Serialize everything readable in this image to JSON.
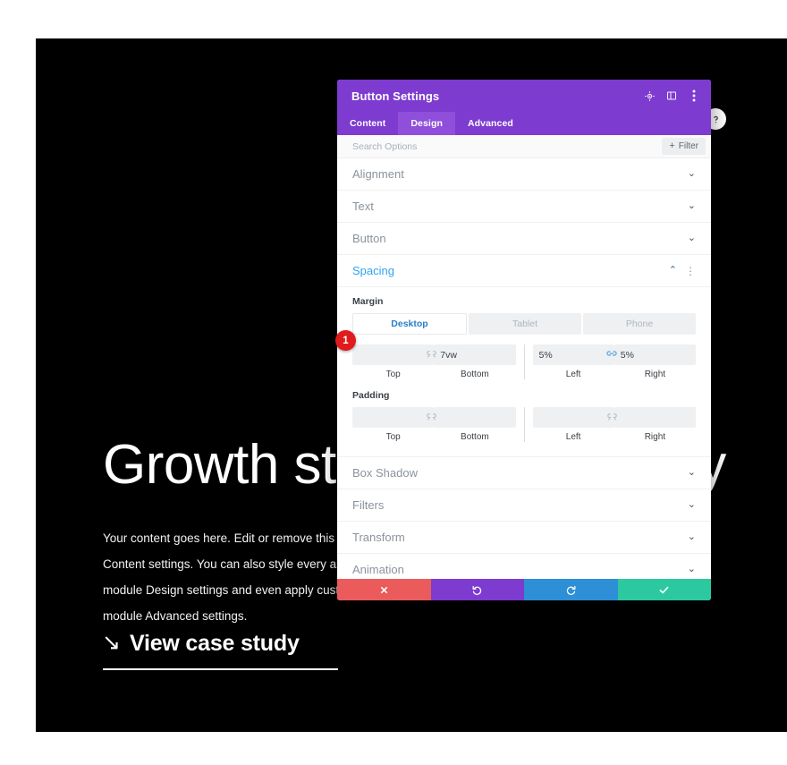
{
  "hero": {
    "heading": "Growth strategy for luxury",
    "paragraph": "Your content goes here. Edit or remove this text inline or in the module Content settings. You can also style every aspect of this content in the module Design settings and even apply custom CSS to this text in the module Advanced settings.",
    "cta_arrow": "↘",
    "cta_label": "View case study"
  },
  "help_fab": {
    "name": "help-button"
  },
  "modal": {
    "title": "Button Settings",
    "header_icons": [
      {
        "name": "target-icon",
        "label": "Reset"
      },
      {
        "name": "layout-panel-icon",
        "label": "Layout"
      },
      {
        "name": "more-vertical-icon",
        "label": "More"
      }
    ],
    "tabs": [
      {
        "label": "Content",
        "active": false
      },
      {
        "label": "Design",
        "active": true
      },
      {
        "label": "Advanced",
        "active": false
      }
    ],
    "search": {
      "placeholder": "Search Options",
      "value": "",
      "filter_label": "Filter",
      "filter_plus": "+"
    },
    "sections_above": [
      {
        "label": "Alignment",
        "state": "collapsed",
        "chevron": "⌄"
      },
      {
        "label": "Text",
        "state": "collapsed",
        "chevron": "⌄"
      },
      {
        "label": "Button",
        "state": "collapsed",
        "chevron": "⌄"
      }
    ],
    "spacing": {
      "label": "Spacing",
      "state": "expanded",
      "chevron": "⌃",
      "dots": "⋮",
      "margin": {
        "label": "Margin",
        "devices": [
          {
            "label": "Desktop",
            "active": true
          },
          {
            "label": "Tablet",
            "active": false
          },
          {
            "label": "Phone",
            "active": false
          }
        ],
        "fields": [
          {
            "caption": "Top",
            "value": "",
            "placeholder": ""
          },
          {
            "caption": "Bottom",
            "value": "7vw",
            "placeholder": ""
          },
          {
            "caption": "Left",
            "value": "5%",
            "placeholder": ""
          },
          {
            "caption": "Right",
            "value": "5%",
            "placeholder": ""
          }
        ],
        "link_left_state": "unlinked",
        "link_right_state": "linked"
      },
      "padding": {
        "label": "Padding",
        "fields": [
          {
            "caption": "Top",
            "value": "",
            "placeholder": ""
          },
          {
            "caption": "Bottom",
            "value": "",
            "placeholder": ""
          },
          {
            "caption": "Left",
            "value": "",
            "placeholder": ""
          },
          {
            "caption": "Right",
            "value": "",
            "placeholder": ""
          }
        ],
        "link_left_state": "unlinked",
        "link_right_state": "unlinked"
      }
    },
    "sections_below": [
      {
        "label": "Box Shadow",
        "state": "collapsed",
        "chevron": "⌄"
      },
      {
        "label": "Filters",
        "state": "collapsed",
        "chevron": "⌄"
      },
      {
        "label": "Transform",
        "state": "collapsed",
        "chevron": "⌄"
      },
      {
        "label": "Animation",
        "state": "collapsed",
        "chevron": "⌄"
      }
    ],
    "footer": [
      {
        "name": "cancel-button",
        "icon": "close-icon"
      },
      {
        "name": "undo-button",
        "icon": "undo-icon"
      },
      {
        "name": "redo-button",
        "icon": "redo-icon"
      },
      {
        "name": "save-button",
        "icon": "check-icon"
      }
    ]
  },
  "annotation": {
    "step_number": "1"
  },
  "colors": {
    "brand_purple": "#7e3bd0",
    "tab_active_purple": "#8f4fdb",
    "accent_blue": "#2ea3f2",
    "badge_red": "#e01b1b",
    "cancel_red": "#eb5b5b",
    "redo_blue": "#2d8fd5",
    "save_green": "#2cc9a0",
    "hero_bg": "#000000"
  }
}
